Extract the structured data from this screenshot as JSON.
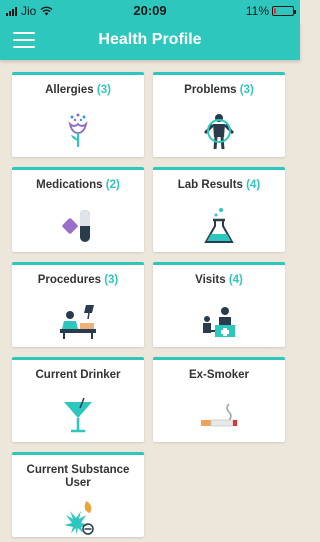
{
  "status": {
    "carrier": "Jio",
    "time": "20:09",
    "battery": "11%",
    "battery_level": 0.11
  },
  "header": {
    "title": "Health Profile"
  },
  "cards": [
    {
      "label": "Allergies",
      "count": "(3)",
      "icon": "allergy-flower-icon"
    },
    {
      "label": "Problems",
      "count": "(3)",
      "icon": "body-problems-icon"
    },
    {
      "label": "Medications",
      "count": "(2)",
      "icon": "pills-icon"
    },
    {
      "label": "Lab Results",
      "count": "(4)",
      "icon": "flask-icon"
    },
    {
      "label": "Procedures",
      "count": "(3)",
      "icon": "surgery-procedure-icon"
    },
    {
      "label": "Visits",
      "count": "(4)",
      "icon": "doctor-visit-icon"
    },
    {
      "label": "Current Drinker",
      "count": "",
      "icon": "cocktail-glass-icon"
    },
    {
      "label": "Ex-Smoker",
      "count": "",
      "icon": "cigarette-icon"
    },
    {
      "label": "Current Substance User",
      "count": "",
      "icon": "leaf-substance-icon"
    }
  ],
  "colors": {
    "accent": "#2ec7be",
    "background": "#ede6db",
    "card": "#ffffff",
    "title_text": "#333333",
    "battery_low": "#e2322b"
  }
}
